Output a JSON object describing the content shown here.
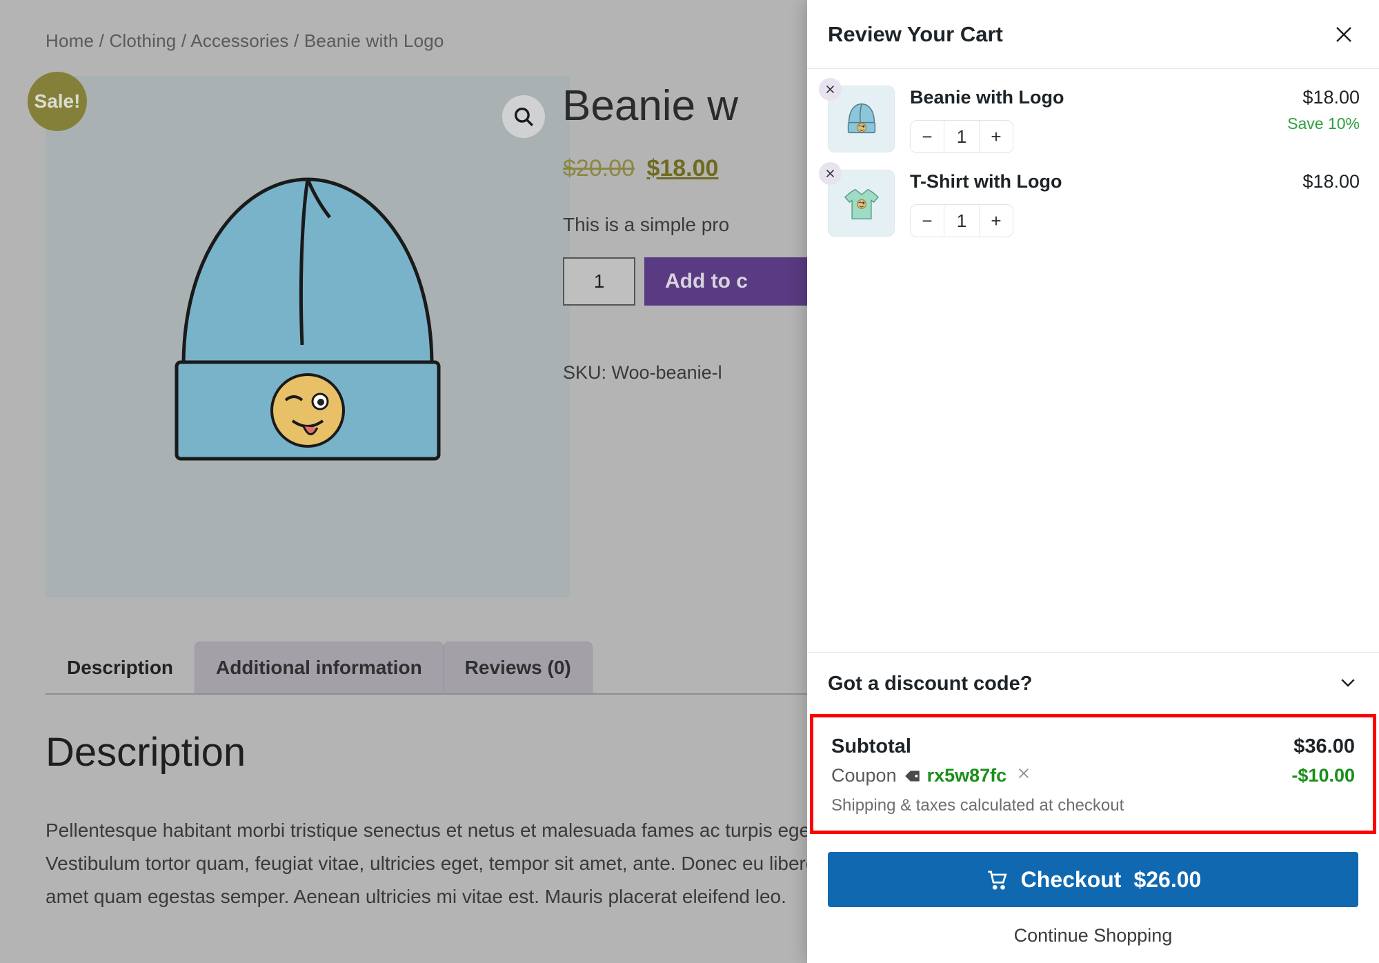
{
  "product_page": {
    "breadcrumb": "Home / Clothing / Accessories / Beanie with Logo",
    "sale_badge": "Sale!",
    "title": "Beanie w",
    "price_old": "$20.00",
    "price_new": "$18.00",
    "short_description": "This is a simple pro",
    "quantity": "1",
    "add_to_cart_label": "Add to c",
    "sku": "SKU: Woo-beanie-l",
    "tabs": [
      {
        "label": "Description",
        "active": true
      },
      {
        "label": "Additional information",
        "active": false
      },
      {
        "label": "Reviews (0)",
        "active": false
      }
    ],
    "description_heading": "Description",
    "description_body": "Pellentesque habitant morbi tristique senectus et netus et malesuada fames ac turpis egestas. Vestibulum tortor quam, feugiat vitae, ultricies eget, tempor sit amet, ante. Donec eu libero sit amet quam egestas semper. Aenean ultricies mi vitae est. Mauris placerat eleifend leo."
  },
  "cart": {
    "title": "Review Your Cart",
    "items": [
      {
        "name": "Beanie with Logo",
        "price": "$18.00",
        "savings": "Save 10%",
        "quantity": "1",
        "decrement": "−",
        "increment": "+"
      },
      {
        "name": "T-Shirt with Logo",
        "price": "$18.00",
        "savings": "",
        "quantity": "1",
        "decrement": "−",
        "increment": "+"
      }
    ],
    "discount_label": "Got a discount code?",
    "subtotal_label": "Subtotal",
    "subtotal_value": "$36.00",
    "coupon_label": "Coupon",
    "coupon_code": "rx5w87fc",
    "coupon_value": "-$10.00",
    "shipping_note": "Shipping & taxes calculated at checkout",
    "checkout_label": "Checkout",
    "checkout_total": "$26.00",
    "continue_label": "Continue Shopping"
  },
  "colors": {
    "accent_blue": "#1069b0",
    "sale_olive": "#84803a",
    "add_cart_purple": "#5a3a82",
    "savings_green": "#2e9e3e",
    "coupon_green": "#1a8f1a",
    "highlight_red": "#ff0000"
  }
}
